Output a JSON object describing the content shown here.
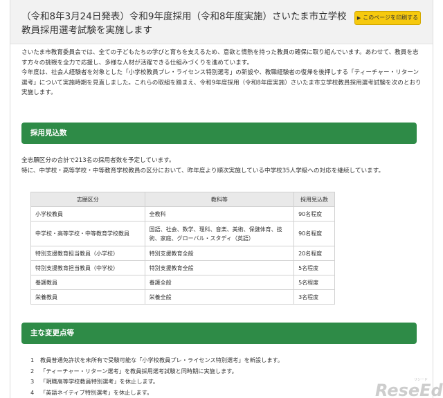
{
  "header": {
    "title": "（令和8年3月24日発表）令和9年度採用（令和8年度実施）さいたま市立学校教員採用選考試験を実施します",
    "print_label": "このページを印刷する"
  },
  "intro": [
    "さいたま市教育委員会では、全ての子どもたちの学びと育ちを支えるため、意欲と情熱を持った教員の確保に取り組んでいます。あわせて、教員を志す方々の挑戦を全力で応援し、多様な人材が活躍できる仕組みづくりを進めています。",
    "今年度は、社会人経験者を対象とした「小学校教員プレ・ライセンス特別選考」の新設や、教職経験者の復帰を後押しする「ティーチャー・リターン選考」について実施時期を見直しました。これらの取組を踏まえ、令和9年度採用（令和8年度実施）さいたま市立学校教員採用選考試験を次のとおり実施します。"
  ],
  "section1": {
    "heading": "採用見込数",
    "lines": [
      "全志願区分の合計で213名の採用者数を予定しています。",
      "特に、中学校・高等学校・中等教育学校教員の区分において、昨年度より順次実施している中学校35人学級への対応を継続しています。"
    ],
    "table": {
      "headers": [
        "志願区分",
        "教科等",
        "採用見込数"
      ],
      "rows": [
        [
          "小学校教員",
          "全教科",
          "90名程度"
        ],
        [
          "中学校・高等学校・中等教育学校教員",
          "国語、社会、数学、理科、音楽、美術、保健体育、技術、家庭、グローバル・スタディ（英語）",
          "90名程度"
        ],
        [
          "特別支援教育担当教員（小学校）",
          "特別支援教育全般",
          "20名程度"
        ],
        [
          "特別支援教育担当教員（中学校）",
          "特別支援教育全般",
          "5名程度"
        ],
        [
          "養護教員",
          "養護全般",
          "5名程度"
        ],
        [
          "栄養教員",
          "栄養全般",
          "3名程度"
        ]
      ]
    }
  },
  "section2": {
    "heading": "主な変更点等",
    "items": [
      {
        "num": "1",
        "text": "教員普通免許状を未所有で受験可能な「小学校教員プレ・ライセンス特別選考」を新設します。"
      },
      {
        "num": "2",
        "text": "「ティーチャー・リターン選考」を教員採用選考試験と同時期に実施します。"
      },
      {
        "num": "3",
        "text": "「現職高等学校教員特別選考」を休止します。"
      },
      {
        "num": "4",
        "text": "「英語ネイティブ特別選考」を休止します。"
      }
    ]
  },
  "watermark": {
    "ruby": "リシード",
    "text": "ReseEd"
  }
}
